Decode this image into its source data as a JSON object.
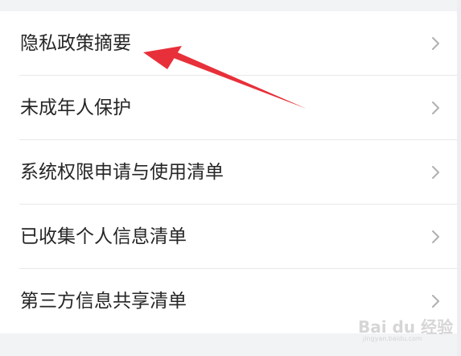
{
  "menu": {
    "items": [
      {
        "label": "隐私政策摘要"
      },
      {
        "label": "未成年人保护"
      },
      {
        "label": "系统权限申请与使用清单"
      },
      {
        "label": "已收集个人信息清单"
      },
      {
        "label": "第三方信息共享清单"
      }
    ]
  },
  "icons": {
    "chevron": "chevron-right-icon",
    "annotation": "red-arrow-icon"
  },
  "colors": {
    "background": "#f2f3f5",
    "card": "#ffffff",
    "text": "#262626",
    "divider": "#e8e8e8",
    "chevron": "#b0b0b0",
    "annotation_arrow": "#e8303a"
  },
  "watermark": {
    "text": "Bai du 经验",
    "subtext": "jingyan.baidu.com"
  }
}
